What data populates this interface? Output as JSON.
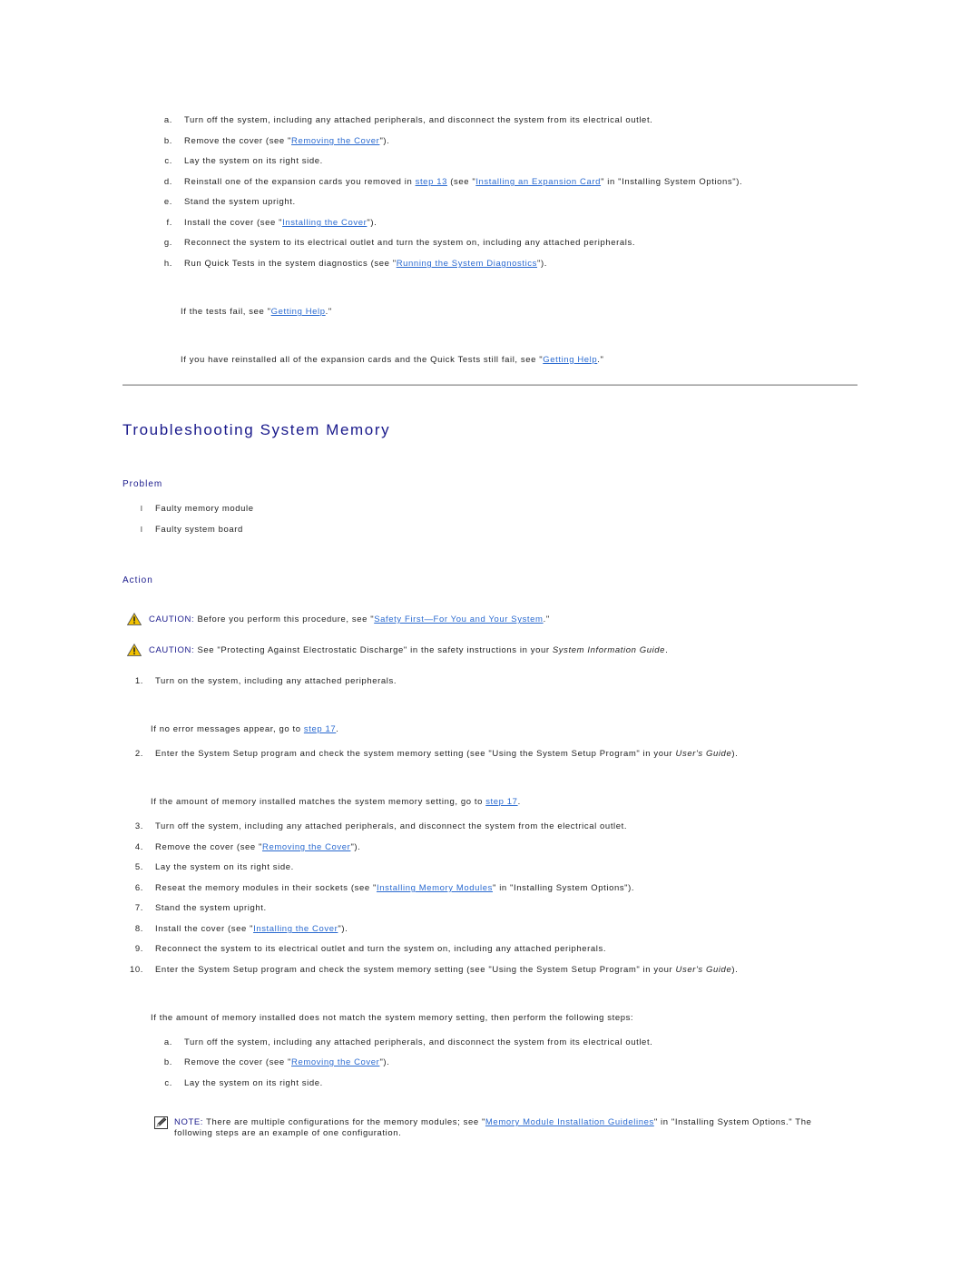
{
  "top_substeps": [
    {
      "marker": "a.",
      "parts": [
        {
          "t": "Turn off the system, including any attached peripherals, and disconnect the system from its electrical outlet."
        }
      ]
    },
    {
      "marker": "b.",
      "parts": [
        {
          "t": "Remove the cover (see \""
        },
        {
          "link": "Removing the Cover"
        },
        {
          "t": "\")."
        }
      ]
    },
    {
      "marker": "c.",
      "parts": [
        {
          "t": "Lay the system on its right side."
        }
      ]
    },
    {
      "marker": "d.",
      "parts": [
        {
          "t": "Reinstall one of the expansion cards you removed in "
        },
        {
          "link": "step 13"
        },
        {
          "t": " (see \""
        },
        {
          "link": "Installing an Expansion Card"
        },
        {
          "t": "\" in \"Installing System Options\")."
        }
      ]
    },
    {
      "marker": "e.",
      "parts": [
        {
          "t": "Stand the system upright."
        }
      ]
    },
    {
      "marker": "f.",
      "parts": [
        {
          "t": "Install the cover (see \""
        },
        {
          "link": "Installing the Cover"
        },
        {
          "t": "\")."
        }
      ]
    },
    {
      "marker": "g.",
      "parts": [
        {
          "t": "Reconnect the system to its electrical outlet and turn the system on, including any attached peripherals."
        }
      ]
    },
    {
      "marker": "h.",
      "parts": [
        {
          "t": "Run Quick Tests in the system diagnostics (see \""
        },
        {
          "link": "Running the System Diagnostics"
        },
        {
          "t": "\")."
        }
      ]
    }
  ],
  "top_notes": [
    {
      "parts": [
        {
          "t": "If the tests fail, see \""
        },
        {
          "link": "Getting Help"
        },
        {
          "t": ".\""
        }
      ]
    },
    {
      "parts": [
        {
          "t": "If you have reinstalled all of the expansion cards and the Quick Tests still fail, see \""
        },
        {
          "link": "Getting Help"
        },
        {
          "t": ".\""
        }
      ]
    }
  ],
  "section_title": "Troubleshooting System Memory",
  "problem_heading": "Problem",
  "problem_items": [
    "Faulty memory module",
    "Faulty system board"
  ],
  "bullet_glyph": "l",
  "action_heading": "Action",
  "cautions": [
    {
      "label": "CAUTION:",
      "parts": [
        {
          "t": " Before you perform this procedure, see \""
        },
        {
          "link": "Safety First—For You and Your System"
        },
        {
          "t": ".\""
        }
      ]
    },
    {
      "label": "CAUTION:",
      "parts": [
        {
          "t": " See \"Protecting Against Electrostatic Discharge\" in the safety instructions in your "
        },
        {
          "em": "System Information Guide"
        },
        {
          "t": "."
        }
      ]
    }
  ],
  "steps": [
    {
      "marker": "1.",
      "parts": [
        {
          "t": "Turn on the system, including any attached peripherals."
        }
      ]
    },
    {
      "note": true,
      "parts": [
        {
          "t": "If no error messages appear, go to "
        },
        {
          "link": "step 17"
        },
        {
          "t": "."
        }
      ]
    },
    {
      "marker": "2.",
      "parts": [
        {
          "t": "Enter the System Setup program and check the system memory setting (see \"Using the System Setup Program\" in your "
        },
        {
          "em": "User's Guide"
        },
        {
          "t": ")."
        }
      ]
    },
    {
      "note": true,
      "parts": [
        {
          "t": "If the amount of memory installed matches the system memory setting, go to "
        },
        {
          "link": "step 17"
        },
        {
          "t": "."
        }
      ]
    },
    {
      "marker": "3.",
      "parts": [
        {
          "t": "Turn off the system, including any attached peripherals, and disconnect the system from the electrical outlet."
        }
      ]
    },
    {
      "marker": "4.",
      "parts": [
        {
          "t": "Remove the cover (see \""
        },
        {
          "link": "Removing the Cover"
        },
        {
          "t": "\")."
        }
      ]
    },
    {
      "marker": "5.",
      "parts": [
        {
          "t": "Lay the system on its right side."
        }
      ]
    },
    {
      "marker": "6.",
      "parts": [
        {
          "t": "Reseat the memory modules in their sockets (see \""
        },
        {
          "link": "Installing Memory Modules"
        },
        {
          "t": "\" in \"Installing System Options\")."
        }
      ]
    },
    {
      "marker": "7.",
      "parts": [
        {
          "t": "Stand the system upright."
        }
      ]
    },
    {
      "marker": "8.",
      "parts": [
        {
          "t": "Install the cover (see \""
        },
        {
          "link": "Installing the Cover"
        },
        {
          "t": "\")."
        }
      ]
    },
    {
      "marker": "9.",
      "parts": [
        {
          "t": "Reconnect the system to its electrical outlet and turn the system on, including any attached peripherals."
        }
      ]
    },
    {
      "marker": "10.",
      "parts": [
        {
          "t": "Enter the System Setup program and check the system memory setting (see \"Using the System Setup Program\" in your "
        },
        {
          "em": "User's Guide"
        },
        {
          "t": ")."
        }
      ]
    },
    {
      "note": true,
      "parts": [
        {
          "t": "If the amount of memory installed does not match the system memory setting, then perform the following steps:"
        }
      ]
    }
  ],
  "bottom_substeps": [
    {
      "marker": "a.",
      "parts": [
        {
          "t": "Turn off the system, including any attached peripherals, and disconnect the system from its electrical outlet."
        }
      ]
    },
    {
      "marker": "b.",
      "parts": [
        {
          "t": "Remove the cover (see \""
        },
        {
          "link": "Removing the Cover"
        },
        {
          "t": "\")."
        }
      ]
    },
    {
      "marker": "c.",
      "parts": [
        {
          "t": "Lay the system on its right side."
        }
      ]
    }
  ],
  "note_block": {
    "label": "NOTE:",
    "line1": [
      {
        "t": " There are multiple configurations for the memory modules; see \""
      },
      {
        "link": "Memory Module Installation Guidelines"
      },
      {
        "t": "\" in \"Installing System Options.\" The"
      }
    ],
    "line2": "following steps are an example of one configuration."
  },
  "colors": {
    "heading": "#1a1a8c",
    "link": "#2a6ad0",
    "text": "#222222",
    "caution_icon": "#f2c200"
  }
}
